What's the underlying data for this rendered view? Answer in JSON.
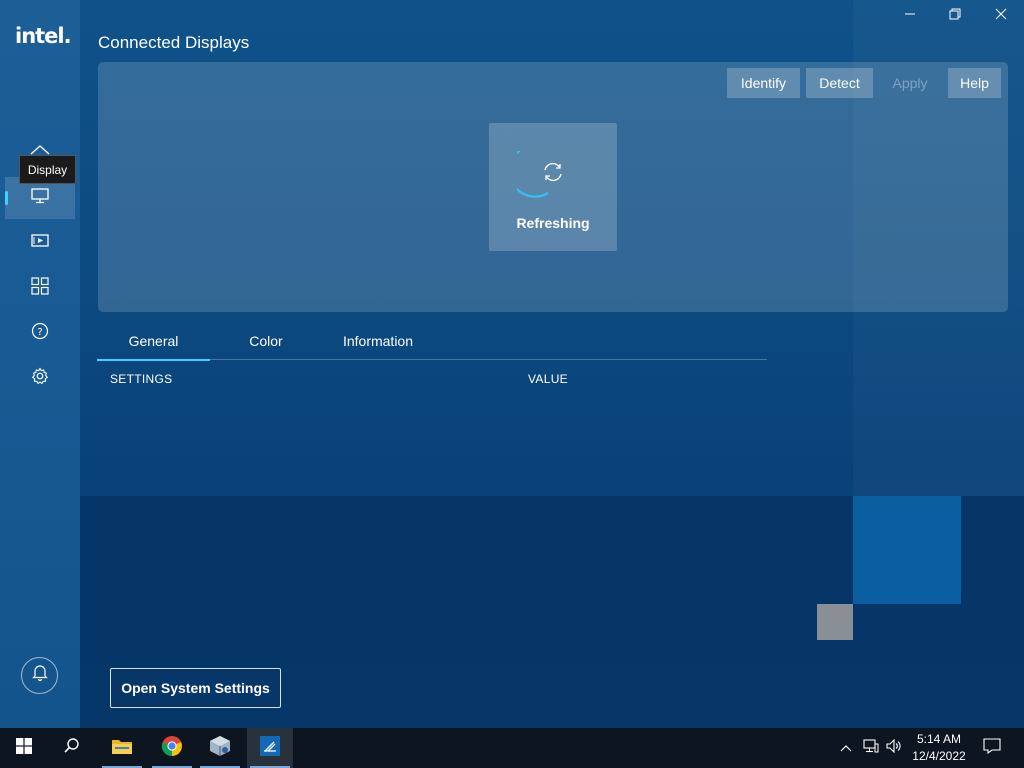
{
  "app": {
    "logo": "intel.",
    "title": "Connected Displays"
  },
  "sidebar": {
    "tooltip": "Display",
    "items": [
      {
        "icon": "display-icon",
        "active": true
      },
      {
        "icon": "video-icon"
      },
      {
        "icon": "apps-grid-icon"
      },
      {
        "icon": "help-circle-icon"
      },
      {
        "icon": "gear-icon"
      }
    ],
    "notification_icon": "bell-icon"
  },
  "toolbar": {
    "identify": "Identify",
    "detect": "Detect",
    "apply": "Apply",
    "help": "Help"
  },
  "status": {
    "refreshing": "Refreshing"
  },
  "tabs": [
    {
      "label": "General",
      "active": true
    },
    {
      "label": "Color"
    },
    {
      "label": "Information"
    }
  ],
  "table": {
    "col_settings": "SETTINGS",
    "col_value": "VALUE"
  },
  "footer": {
    "open_system_settings": "Open System Settings"
  },
  "taskbar": {
    "time": "5:14 AM",
    "date": "12/4/2022"
  },
  "colors": {
    "accent": "#3fd0ff",
    "background": "#0c4a80",
    "taskbar": "#0c1520"
  }
}
